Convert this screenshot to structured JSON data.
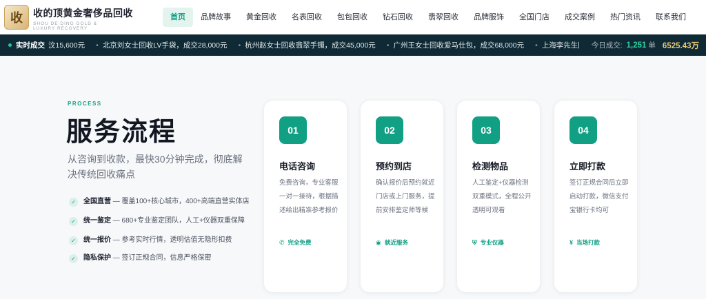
{
  "brand": {
    "logo_char": "收",
    "name": "收的顶黄金奢侈品回收",
    "subtitle": "SHOU DE DING GOLD & LUXURY RECOVERY"
  },
  "nav": [
    "首页",
    "品牌故事",
    "黄金回收",
    "名表回收",
    "包包回收",
    "钻石回收",
    "翡翠回收",
    "品牌服饰",
    "全国门店",
    "成交案例",
    "热门资讯",
    "联系我们"
  ],
  "ticker": {
    "label": "实时成交",
    "items": [
      "汶15,600元",
      "北京刘女士回收LV手袋，成交28,000元",
      "杭州赵女士回收翡翠手镯，成交45,000元",
      "广州王女士回收爱马仕包，成交68,000元",
      "上海李先生回收劳力士"
    ],
    "stats_label": "今日成交:",
    "count": "1,251",
    "count_unit": "单",
    "amount": "6525.43万"
  },
  "process": {
    "eyebrow": "PROCESS",
    "title": "服务流程",
    "subtitle": "从咨询到收款，最快30分钟完成，彻底解决传统回收痛点",
    "features": [
      {
        "title": "全国直营",
        "text": " — 覆盖100+核心城市，400+高端直营实体店"
      },
      {
        "title": "统一鉴定",
        "text": " — 680+专业鉴定团队，人工+仪器双重保障"
      },
      {
        "title": "统一报价",
        "text": " — 参考实时行情，透明估值无隐形扣费"
      },
      {
        "title": "隐私保护",
        "text": " — 签订正规合同，信息严格保密"
      }
    ],
    "steps": [
      {
        "num": "01",
        "title": "电话咨询",
        "desc": "免费咨询，专业客服一对一接待，根据描述给出精准参考报价",
        "tag": "完全免费",
        "icon": "phone-icon",
        "glyph": "✆"
      },
      {
        "num": "02",
        "title": "预约到店",
        "desc": "确认报价后预约就近门店或上门服务，提前安排鉴定师等候",
        "tag": "就近服务",
        "icon": "location-icon",
        "glyph": "◉"
      },
      {
        "num": "03",
        "title": "检测物品",
        "desc": "人工鉴定+仪器检测双重模式，全程公开透明可观看",
        "tag": "专业仪器",
        "icon": "shield-icon",
        "glyph": "⛨"
      },
      {
        "num": "04",
        "title": "立即打款",
        "desc": "签订正规合同后立即启动打款，微信支付宝银行卡均可",
        "tag": "当场打款",
        "icon": "money-icon",
        "glyph": "¥"
      }
    ]
  }
}
